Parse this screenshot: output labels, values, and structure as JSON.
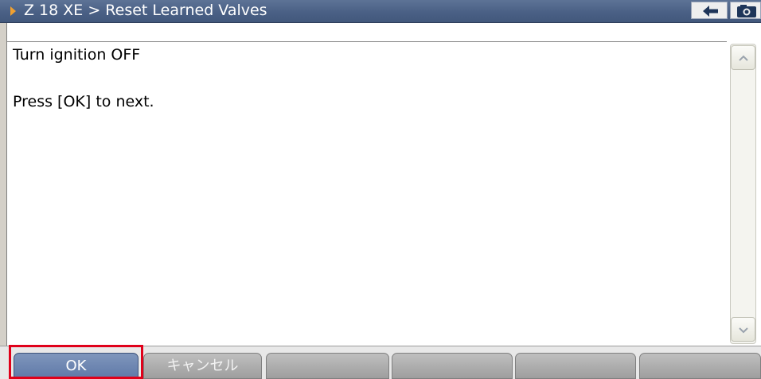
{
  "header": {
    "title": "Z 18 XE > Reset Learned Valves",
    "back_icon": "back-arrow-icon",
    "camera_icon": "camera-icon"
  },
  "main": {
    "lines": [
      "Turn ignition OFF",
      "Press [OK] to next."
    ]
  },
  "softkeys": {
    "ok_label": "OK",
    "cancel_label": "キャンセル",
    "empty_count": 4
  },
  "colors": {
    "title_bar": "#4a6085",
    "ok_button": "#6a83b0",
    "highlight": "#e0001a"
  }
}
